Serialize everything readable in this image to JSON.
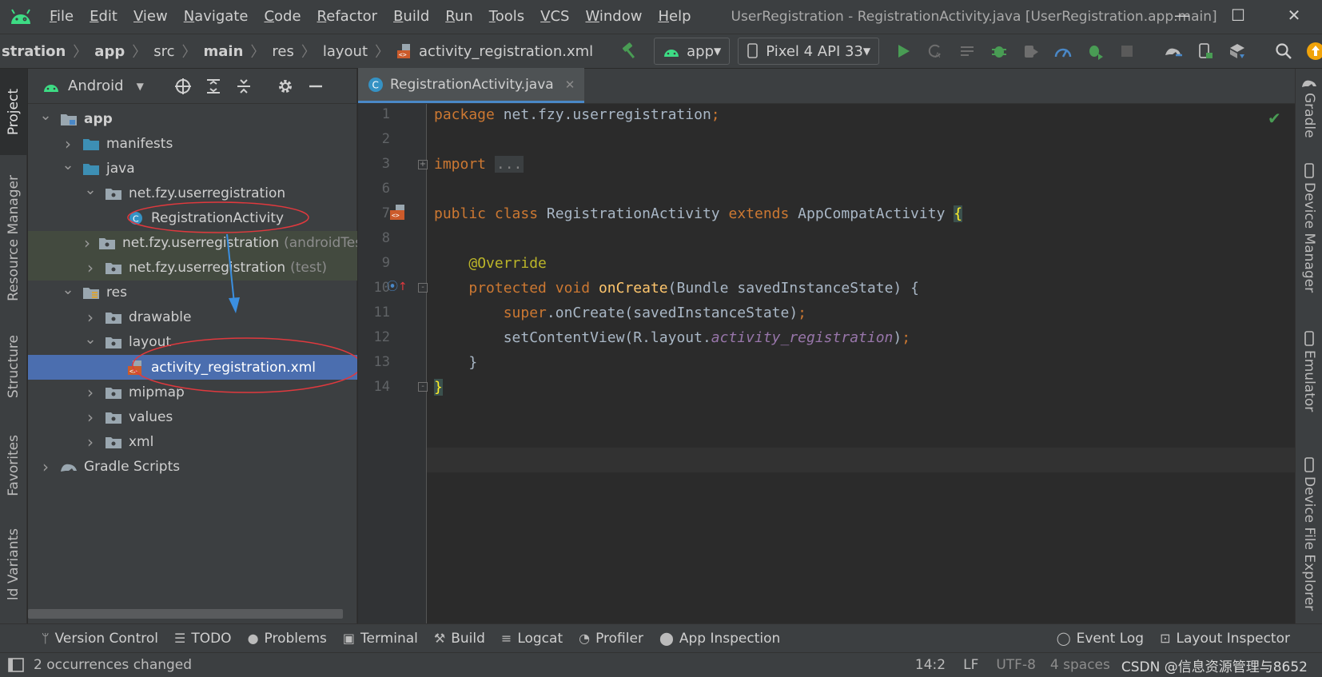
{
  "menu": {
    "items": [
      "File",
      "Edit",
      "View",
      "Navigate",
      "Code",
      "Refactor",
      "Build",
      "Run",
      "Tools",
      "VCS",
      "Window",
      "Help"
    ],
    "window_title": "UserRegistration - RegistrationActivity.java [UserRegistration.app.main]",
    "controls": [
      "—",
      "☐",
      "✕"
    ]
  },
  "breadcrumb": [
    "stration",
    "app",
    "src",
    "main",
    "res",
    "layout",
    "activity_registration.xml"
  ],
  "toolbar": {
    "run_config": "app",
    "device": "Pixel 4 API 33"
  },
  "left_tabs": [
    "Project",
    "Resource Manager",
    "Structure",
    "Favorites",
    "ld Variants"
  ],
  "right_tabs": [
    "Gradle",
    "Device Manager",
    "Emulator",
    "Device File Explorer"
  ],
  "project": {
    "view_mode": "Android",
    "tree": [
      {
        "label": "app",
        "depth": 0,
        "arrow": "open",
        "icon": "module"
      },
      {
        "label": "manifests",
        "depth": 1,
        "arrow": "closed",
        "icon": "folder"
      },
      {
        "label": "java",
        "depth": 1,
        "arrow": "open",
        "icon": "folder"
      },
      {
        "label": "net.fzy.userregistration",
        "depth": 2,
        "arrow": "open",
        "icon": "package"
      },
      {
        "label": "RegistrationActivity",
        "depth": 3,
        "arrow": "none",
        "icon": "class"
      },
      {
        "label": "net.fzy.userregistration",
        "suffix": "(androidTest)",
        "depth": 2,
        "arrow": "closed",
        "icon": "package",
        "style": "test"
      },
      {
        "label": "net.fzy.userregistration",
        "suffix": "(test)",
        "depth": 2,
        "arrow": "closed",
        "icon": "package",
        "style": "test"
      },
      {
        "label": "res",
        "depth": 1,
        "arrow": "open",
        "icon": "res-folder"
      },
      {
        "label": "drawable",
        "depth": 2,
        "arrow": "closed",
        "icon": "package"
      },
      {
        "label": "layout",
        "depth": 2,
        "arrow": "open",
        "icon": "package"
      },
      {
        "label": "activity_registration.xml",
        "depth": 3,
        "arrow": "none",
        "icon": "xml",
        "style": "selected"
      },
      {
        "label": "mipmap",
        "depth": 2,
        "arrow": "closed",
        "icon": "package"
      },
      {
        "label": "values",
        "depth": 2,
        "arrow": "closed",
        "icon": "package"
      },
      {
        "label": "xml",
        "depth": 2,
        "arrow": "closed",
        "icon": "package"
      },
      {
        "label": "Gradle Scripts",
        "depth": 0,
        "arrow": "closed",
        "icon": "gradle"
      }
    ]
  },
  "editor": {
    "tab_label": "RegistrationActivity.java",
    "line_numbers": [
      "1",
      "2",
      "3",
      "6",
      "7",
      "8",
      "9",
      "10",
      "11",
      "12",
      "13",
      "14"
    ],
    "code": {
      "l1_kw": "package",
      "l1_rest": " net.fzy.userregistration",
      "semi": ";",
      "l3_kw": "import",
      "l3_fold": "...",
      "l7_kw1": "public",
      "l7_kw2": "class",
      "l7_name": " RegistrationActivity ",
      "l7_kw3": "extends",
      "l7_base": " AppCompatActivity ",
      "brace_open": "{",
      "l9_ann": "@Override",
      "l10_kw1": "protected",
      "l10_kw2": "void",
      "l10_fn": "onCreate",
      "l10_rest": "(Bundle savedInstanceState) {",
      "l11_kw": "super",
      "l11_rest": ".onCreate(savedInstanceState)",
      "l12_pre": "setContentView(R.layout.",
      "l12_field": "activity_registration",
      "l12_post": ")",
      "l13": "}",
      "brace_close": "}"
    }
  },
  "bottom_tools": [
    {
      "label": "Version Control",
      "icon": "branch-icon",
      "glyph": "ᛘ"
    },
    {
      "label": "TODO",
      "icon": "list-icon",
      "glyph": "☰"
    },
    {
      "label": "Problems",
      "icon": "problems-icon",
      "glyph": "●"
    },
    {
      "label": "Terminal",
      "icon": "terminal-icon",
      "glyph": "▣"
    },
    {
      "label": "Build",
      "icon": "hammer-icon",
      "glyph": "⚒"
    },
    {
      "label": "Logcat",
      "icon": "logcat-icon",
      "glyph": "≡"
    },
    {
      "label": "Profiler",
      "icon": "profiler-icon",
      "glyph": "◔"
    },
    {
      "label": "App Inspection",
      "icon": "inspection-icon",
      "glyph": "⬤"
    }
  ],
  "bottom_right_tools": [
    {
      "label": "Event Log",
      "icon": "event-log-icon",
      "glyph": "◯"
    },
    {
      "label": "Layout Inspector",
      "icon": "layout-inspector-icon",
      "glyph": "⊡"
    }
  ],
  "status": {
    "message": "2 occurrences changed",
    "position": "14:2",
    "line_sep": "LF",
    "encoding": "UTF-8",
    "indent": "4 spaces",
    "watermark": "CSDN @信息资源管理与8652"
  },
  "colors": {
    "accent": "#4b6eaf",
    "run_green": "#499c54",
    "android_green": "#3ddc84",
    "annotation_red": "#e0393e",
    "arrow_blue": "#3b8fe0"
  }
}
